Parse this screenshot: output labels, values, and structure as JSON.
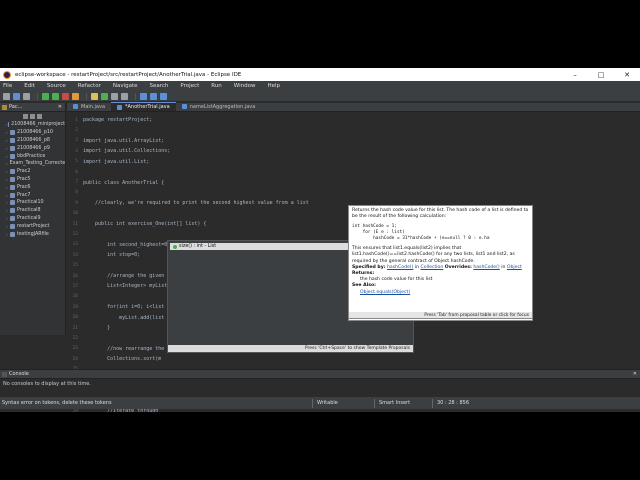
{
  "window": {
    "title": "eclipse-workspace - restartProject/src/restartProject/AnotherTrial.java - Eclipse IDE",
    "controls": [
      "–",
      "□",
      "✕"
    ]
  },
  "menu": [
    "File",
    "Edit",
    "Source",
    "Refactor",
    "Navigate",
    "Search",
    "Project",
    "Run",
    "Window",
    "Help"
  ],
  "explorer": {
    "tab_label": "Pac...",
    "items": [
      "21008466_miniproject",
      "21008466_p10",
      "21008466_p8",
      "21008466_p9",
      "bbdPractice",
      "Exam_Testing_Corrected",
      "Prac2",
      "Prac5",
      "Prac6",
      "Prac7",
      "Practical10",
      "Practical8",
      "Practical9",
      "restartProject",
      "testingJARfile"
    ]
  },
  "editor": {
    "tabs": [
      "Main.java",
      "*AnotherTrial.java",
      "nameListAggregation.java"
    ],
    "active_tab": 1,
    "lines": [
      {
        "n": "1",
        "t": "package restartProject;"
      },
      {
        "n": "2",
        "t": ""
      },
      {
        "n": "3",
        "t": "import java.util.ArrayList;"
      },
      {
        "n": "4",
        "t": "import java.util.Collections;"
      },
      {
        "n": "5",
        "t": "import java.util.List;"
      },
      {
        "n": "6",
        "t": ""
      },
      {
        "n": "7",
        "t": "public class AnotherTrial {"
      },
      {
        "n": "8",
        "t": ""
      },
      {
        "n": "9",
        "t": "    //clearly, we're required to print the second highest value from a list"
      },
      {
        "n": "10",
        "t": ""
      },
      {
        "n": "11",
        "t": "    public int exercise_One(int[] list) {"
      },
      {
        "n": "12",
        "t": ""
      },
      {
        "n": "13",
        "t": "        int second_highest=0;"
      },
      {
        "n": "14",
        "t": "        int stop=0;"
      },
      {
        "n": "15",
        "t": ""
      },
      {
        "n": "16",
        "t": "        //arrange the given"
      },
      {
        "n": "17",
        "t": "        List<Integer> myList"
      },
      {
        "n": "18",
        "t": ""
      },
      {
        "n": "19",
        "t": "        for(int i=0; i<list"
      },
      {
        "n": "20",
        "t": "            myList.add(list"
      },
      {
        "n": "21",
        "t": "        }"
      },
      {
        "n": "22",
        "t": ""
      },
      {
        "n": "23",
        "t": "        //now rearrange the"
      },
      {
        "n": "24",
        "t": "        Collections.sort(m"
      },
      {
        "n": "25",
        "t": ""
      },
      {
        "n": "26",
        "t": "        //get the maximum"
      },
      {
        "n": "27",
        "t": "        int maximum=myList"
      },
      {
        "n": "28",
        "t": ""
      },
      {
        "n": "29",
        "t": "        //iterate through"
      },
      {
        "n": "30",
        "t": "        for(int i:myList.si)"
      },
      {
        "n": "31",
        "t": ""
      },
      {
        "n": "32",
        "t": "        return second_highest;"
      },
      {
        "n": "33",
        "t": "    }"
      },
      {
        "n": "34",
        "t": "}"
      }
    ]
  },
  "content_assist": {
    "item": "size() : int - List",
    "footer": "Press 'Ctrl+Space' to show Template Proposals"
  },
  "javadoc": {
    "p1": "Returns the hash code value for this list. The hash code of a list is defined to be the result of the following calculation:",
    "code": "int hashCode = 1;\n    for (E e : list)\n        hashCode = 31*hashCode + (e==null ? 0 : e.ha",
    "p2": "This ensures that list1.equals(list2) implies that list1.hashCode()==list2.hashCode() for any two lists, list1 and list2, as required by the general contract of Object.hashCode.",
    "specified_label": "Specified by:",
    "specified_link": "hashCode()",
    "specified_in": "in",
    "specified_class": "Collection",
    "overrides_label": "Overrides:",
    "overrides_link": "hashCode()",
    "overrides_class": "Object",
    "returns_label": "Returns:",
    "returns_text": "the hash code value for this list",
    "see_label": "See Also:",
    "see_link": "Object.equals(Object)",
    "footer": "Press 'Tab' from proposal table or click for focus"
  },
  "console": {
    "tab_label": "Console",
    "message": "No consoles to display at this time."
  },
  "status": {
    "message": "Syntax error on tokens, delete these tokens",
    "writable": "Writable",
    "insert": "Smart Insert",
    "position": "30 : 28 : 856"
  }
}
